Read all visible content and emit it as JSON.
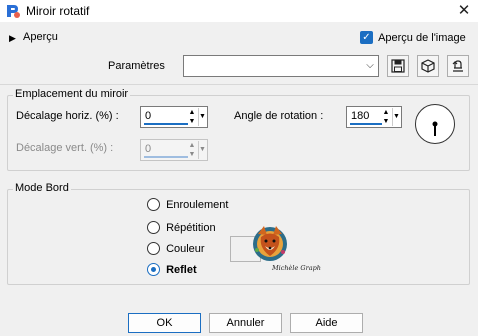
{
  "window": {
    "title": "Miroir rotatif",
    "close_glyph": "✕",
    "icon": "paintshop-pro-icon"
  },
  "preview": {
    "toggle_label": "Aperçu",
    "checkbox_label": "Aperçu de l'image",
    "checkbox_checked": true
  },
  "params": {
    "label": "Paramètres",
    "value": "",
    "buttons": [
      "save-preset-icon",
      "reset-preset-icon",
      "restore-default-icon"
    ]
  },
  "mirror": {
    "group_title": "Emplacement du miroir",
    "horiz_label": "Décalage horiz. (%) :",
    "horiz_value": "0",
    "vert_label": "Décalage vert. (%) :",
    "vert_value": "0",
    "vert_enabled": false,
    "angle_label": "Angle de rotation :",
    "angle_value": "180"
  },
  "edge": {
    "group_title": "Mode Bord",
    "options": [
      {
        "label": "Enroulement",
        "checked": false
      },
      {
        "label": "Répétition",
        "checked": false
      },
      {
        "label": "Couleur",
        "checked": false
      },
      {
        "label": "Reflet",
        "checked": true
      }
    ],
    "logo_text": "Michèle Graph"
  },
  "buttons": {
    "ok": "OK",
    "cancel": "Annuler",
    "help": "Aide"
  },
  "colors": {
    "accent": "#1b6ec2",
    "background": "#f0f0f0"
  }
}
